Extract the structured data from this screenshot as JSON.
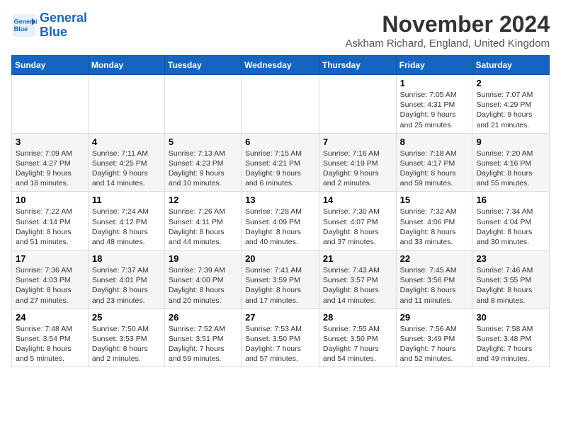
{
  "header": {
    "logo_line1": "General",
    "logo_line2": "Blue",
    "month_title": "November 2024",
    "subtitle": "Askham Richard, England, United Kingdom"
  },
  "weekdays": [
    "Sunday",
    "Monday",
    "Tuesday",
    "Wednesday",
    "Thursday",
    "Friday",
    "Saturday"
  ],
  "weeks": [
    [
      {
        "day": "",
        "info": ""
      },
      {
        "day": "",
        "info": ""
      },
      {
        "day": "",
        "info": ""
      },
      {
        "day": "",
        "info": ""
      },
      {
        "day": "",
        "info": ""
      },
      {
        "day": "1",
        "info": "Sunrise: 7:05 AM\nSunset: 4:31 PM\nDaylight: 9 hours and 25 minutes."
      },
      {
        "day": "2",
        "info": "Sunrise: 7:07 AM\nSunset: 4:29 PM\nDaylight: 9 hours and 21 minutes."
      }
    ],
    [
      {
        "day": "3",
        "info": "Sunrise: 7:09 AM\nSunset: 4:27 PM\nDaylight: 9 hours and 18 minutes."
      },
      {
        "day": "4",
        "info": "Sunrise: 7:11 AM\nSunset: 4:25 PM\nDaylight: 9 hours and 14 minutes."
      },
      {
        "day": "5",
        "info": "Sunrise: 7:13 AM\nSunset: 4:23 PM\nDaylight: 9 hours and 10 minutes."
      },
      {
        "day": "6",
        "info": "Sunrise: 7:15 AM\nSunset: 4:21 PM\nDaylight: 9 hours and 6 minutes."
      },
      {
        "day": "7",
        "info": "Sunrise: 7:16 AM\nSunset: 4:19 PM\nDaylight: 9 hours and 2 minutes."
      },
      {
        "day": "8",
        "info": "Sunrise: 7:18 AM\nSunset: 4:17 PM\nDaylight: 8 hours and 59 minutes."
      },
      {
        "day": "9",
        "info": "Sunrise: 7:20 AM\nSunset: 4:16 PM\nDaylight: 8 hours and 55 minutes."
      }
    ],
    [
      {
        "day": "10",
        "info": "Sunrise: 7:22 AM\nSunset: 4:14 PM\nDaylight: 8 hours and 51 minutes."
      },
      {
        "day": "11",
        "info": "Sunrise: 7:24 AM\nSunset: 4:12 PM\nDaylight: 8 hours and 48 minutes."
      },
      {
        "day": "12",
        "info": "Sunrise: 7:26 AM\nSunset: 4:11 PM\nDaylight: 8 hours and 44 minutes."
      },
      {
        "day": "13",
        "info": "Sunrise: 7:28 AM\nSunset: 4:09 PM\nDaylight: 8 hours and 40 minutes."
      },
      {
        "day": "14",
        "info": "Sunrise: 7:30 AM\nSunset: 4:07 PM\nDaylight: 8 hours and 37 minutes."
      },
      {
        "day": "15",
        "info": "Sunrise: 7:32 AM\nSunset: 4:06 PM\nDaylight: 8 hours and 33 minutes."
      },
      {
        "day": "16",
        "info": "Sunrise: 7:34 AM\nSunset: 4:04 PM\nDaylight: 8 hours and 30 minutes."
      }
    ],
    [
      {
        "day": "17",
        "info": "Sunrise: 7:36 AM\nSunset: 4:03 PM\nDaylight: 8 hours and 27 minutes."
      },
      {
        "day": "18",
        "info": "Sunrise: 7:37 AM\nSunset: 4:01 PM\nDaylight: 8 hours and 23 minutes."
      },
      {
        "day": "19",
        "info": "Sunrise: 7:39 AM\nSunset: 4:00 PM\nDaylight: 8 hours and 20 minutes."
      },
      {
        "day": "20",
        "info": "Sunrise: 7:41 AM\nSunset: 3:59 PM\nDaylight: 8 hours and 17 minutes."
      },
      {
        "day": "21",
        "info": "Sunrise: 7:43 AM\nSunset: 3:57 PM\nDaylight: 8 hours and 14 minutes."
      },
      {
        "day": "22",
        "info": "Sunrise: 7:45 AM\nSunset: 3:56 PM\nDaylight: 8 hours and 11 minutes."
      },
      {
        "day": "23",
        "info": "Sunrise: 7:46 AM\nSunset: 3:55 PM\nDaylight: 8 hours and 8 minutes."
      }
    ],
    [
      {
        "day": "24",
        "info": "Sunrise: 7:48 AM\nSunset: 3:54 PM\nDaylight: 8 hours and 5 minutes."
      },
      {
        "day": "25",
        "info": "Sunrise: 7:50 AM\nSunset: 3:53 PM\nDaylight: 8 hours and 2 minutes."
      },
      {
        "day": "26",
        "info": "Sunrise: 7:52 AM\nSunset: 3:51 PM\nDaylight: 7 hours and 59 minutes."
      },
      {
        "day": "27",
        "info": "Sunrise: 7:53 AM\nSunset: 3:50 PM\nDaylight: 7 hours and 57 minutes."
      },
      {
        "day": "28",
        "info": "Sunrise: 7:55 AM\nSunset: 3:50 PM\nDaylight: 7 hours and 54 minutes."
      },
      {
        "day": "29",
        "info": "Sunrise: 7:56 AM\nSunset: 3:49 PM\nDaylight: 7 hours and 52 minutes."
      },
      {
        "day": "30",
        "info": "Sunrise: 7:58 AM\nSunset: 3:48 PM\nDaylight: 7 hours and 49 minutes."
      }
    ]
  ]
}
